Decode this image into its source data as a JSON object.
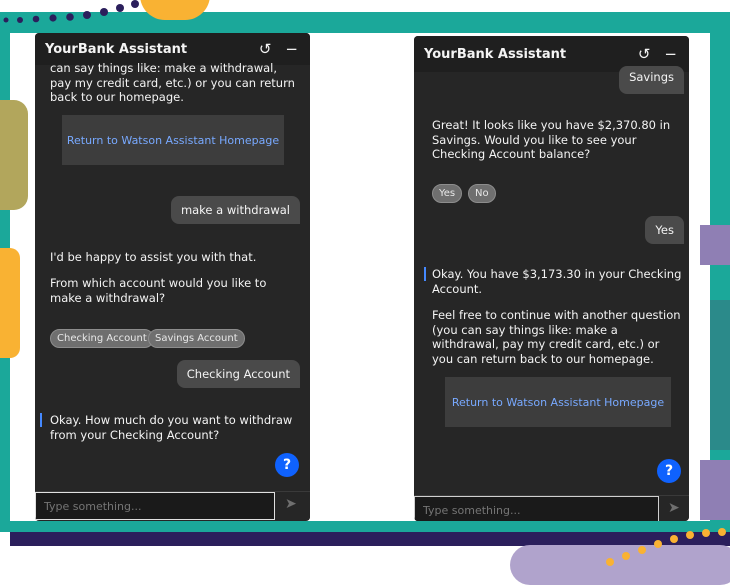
{
  "colors": {
    "teal": "#1ba89a",
    "navy": "#2b1f5c",
    "purple": "#8f7fb4",
    "orange": "#f9b233",
    "olive": "#b2a65c",
    "accent": "#4589ff",
    "link": "#78a9ff"
  },
  "left_panel": {
    "header_title": "YourBank Assistant",
    "header_icons": [
      "restart-icon",
      "minimize-icon"
    ],
    "cut_text": "can say things like: make a withdrawal, pay my credit card, etc.) or you can return back to our homepage.",
    "home_button": "Return to Watson Assistant Homepage",
    "user_msg_1": "make a withdrawal",
    "bot_msg_1": "I'd be happy to assist you with that.",
    "bot_msg_2": "From which account would you like to make a withdrawal?",
    "options": [
      "Checking Account",
      "Savings Account"
    ],
    "user_msg_2": "Checking Account",
    "bot_msg_3": "Okay. How much do you want to withdraw from your Checking Account?",
    "help_label": "?",
    "input_placeholder": "Type something..."
  },
  "right_panel": {
    "header_title": "YourBank Assistant",
    "user_msg_cut": "Savings",
    "bot_msg_1": "Great! It looks like you have $2,370.80 in Savings. Would you like to see your Checking Account balance?",
    "options": [
      "Yes",
      "No"
    ],
    "user_msg_2": "Yes",
    "bot_msg_2": "Okay. You have $3,173.30 in your Checking Account.",
    "bot_msg_3": "Feel free to continue with another question (you can say things like: make a withdrawal, pay my credit card, etc.) or you can return back to our homepage.",
    "home_button": "Return to Watson Assistant Homepage",
    "help_label": "?",
    "input_placeholder": "Type something..."
  }
}
